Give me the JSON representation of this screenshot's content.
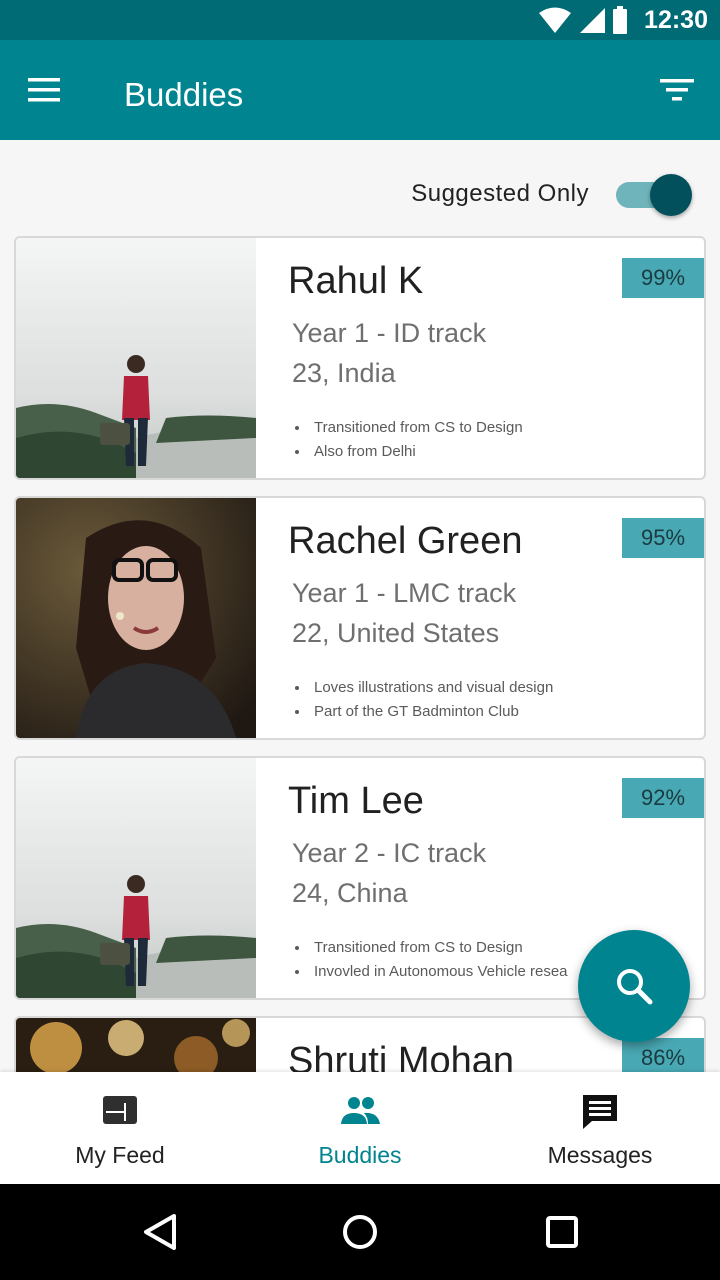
{
  "status_bar": {
    "time": "12:30"
  },
  "app_bar": {
    "title": "Buddies"
  },
  "filter": {
    "toggle_label": "Suggested Only",
    "toggle_on": true
  },
  "buddies": [
    {
      "name": "Rahul K",
      "track": "Year 1 - ID track",
      "origin": "23, India",
      "match": "99%",
      "notes": [
        "Transitioned from CS to Design",
        "Also from Delhi"
      ]
    },
    {
      "name": "Rachel Green",
      "track": "Year 1 - LMC track",
      "origin": "22, United States",
      "match": "95%",
      "notes": [
        "Loves illustrations and visual design",
        "Part of the GT Badminton Club"
      ]
    },
    {
      "name": "Tim Lee",
      "track": "Year 2 - IC track",
      "origin": "24, China",
      "match": "92%",
      "notes": [
        "Transitioned from CS to Design",
        "Invovled in Autonomous Vehicle resea"
      ]
    },
    {
      "name": "Shruti Mohan",
      "match": "86%"
    }
  ],
  "bottom_nav": [
    {
      "label": "My Feed",
      "icon": "feed-icon"
    },
    {
      "label": "Buddies",
      "icon": "people-icon",
      "active": true
    },
    {
      "label": "Messages",
      "icon": "message-icon"
    }
  ],
  "colors": {
    "primary": "#00848f",
    "status_bar": "#006b75",
    "match_badge": "#48a8b4",
    "toggle_thumb": "#02505b"
  }
}
